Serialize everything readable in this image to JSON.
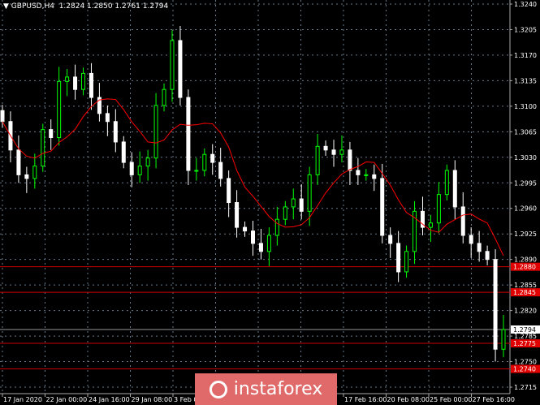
{
  "title": {
    "symbol": "GBPUSD,H4",
    "ohlc": "1.2824 1.2850 1.2761 1.2794"
  },
  "logo": {
    "text": "instaforex"
  },
  "colors": {
    "bull": "#00ff00",
    "bear": "#ffffff",
    "ma": "#ff0000",
    "level": "#cc0000",
    "grid": "#6a7a8a"
  },
  "chart_data": {
    "type": "candlestick",
    "ylim": [
      1.2715,
      1.324
    ],
    "yticks": [
      "1.3240",
      "1.3205",
      "1.3170",
      "1.3135",
      "1.3100",
      "1.3065",
      "1.3030",
      "1.2995",
      "1.2960",
      "1.2925",
      "1.2890",
      "1.2855",
      "1.2820",
      "1.2785",
      "1.2750",
      "1.2715"
    ],
    "xticks": [
      "17 Jan 2020",
      "22 Jan 00:00",
      "24 Jan 16:00",
      "29 Jan 08:00",
      "3 Feb 00:00",
      "",
      "",
      "",
      "17 Feb 16:00",
      "20 Feb 08:00",
      "25 Feb 00:00",
      "27 Feb 16:00"
    ],
    "closes": [
      1.3079,
      1.304,
      1.3006,
      1.3001,
      1.3018,
      1.3068,
      1.3057,
      1.3134,
      1.314,
      1.3123,
      1.3145,
      1.3112,
      1.309,
      1.3079,
      1.3051,
      1.3023,
      1.3006,
      1.3018,
      1.3029,
      1.3101,
      1.3123,
      1.319,
      1.3112,
      1.3012,
      1.3012,
      1.3034,
      1.3023,
      1.3001,
      1.2968,
      1.2934,
      1.2929,
      1.2912,
      1.2901,
      1.2923,
      1.2945,
      1.2962,
      1.2973,
      1.2956,
      1.3006,
      1.3045,
      1.304,
      1.3034,
      1.304,
      1.3012,
      1.3006,
      1.3006,
      1.3001,
      1.2923,
      1.2912,
      1.2873,
      1.2901,
      1.2956,
      1.2934,
      1.294,
      1.2979,
      1.3012,
      1.2962,
      1.2923,
      1.2912,
      1.2901,
      1.289,
      1.2767,
      1.2794
    ],
    "ma_period": 8,
    "levels": [
      {
        "price": 1.288,
        "label": "1.2880"
      },
      {
        "price": 1.2845,
        "label": "1.2845"
      },
      {
        "price": 1.2775,
        "label": "1.2775"
      },
      {
        "price": 1.274,
        "label": "1.2740"
      }
    ],
    "current": {
      "price": 1.2794,
      "label": "1.2794"
    }
  }
}
